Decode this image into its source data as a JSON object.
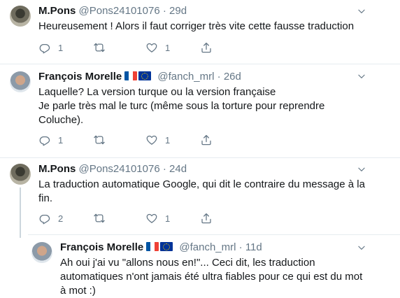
{
  "tweets": [
    {
      "author": "M.Pons",
      "handle": "@Pons24101076",
      "separator": "·",
      "time": "29d",
      "text": "Heureusement ! Alors il faut corriger très vite cette fausse traduction",
      "replies": "1",
      "likes": "1"
    },
    {
      "author": "François Morelle",
      "flags": [
        "flag-fr",
        "flag-eu"
      ],
      "handle": "@fanch_mrl",
      "separator": "·",
      "time": "26d",
      "text_lines": [
        "Laquelle? La version turque ou la version française",
        "Je parle très mal le turc (même sous la torture pour reprendre",
        "Coluche)."
      ],
      "replies": "1",
      "likes": "1"
    },
    {
      "author": "M.Pons",
      "handle": "@Pons24101076",
      "separator": "·",
      "time": "24d",
      "text_lines": [
        "La traduction automatique Google, qui dit le contraire du message à la",
        "fin."
      ],
      "replies": "2",
      "likes": "1"
    },
    {
      "author": "François Morelle",
      "flags": [
        "flag-fr",
        "flag-eu"
      ],
      "handle": "@fanch_mrl",
      "separator": "·",
      "time": "11d",
      "text_lines": [
        "Ah oui j'ai vu \"allons nous en!\"... Ceci dit, les traduction",
        "automatiques n'ont jamais été ultra fiables pour ce qui est du mot",
        "à mot :)"
      ]
    }
  ],
  "icons": {
    "reply": "reply-icon",
    "retweet": "retweet-icon",
    "like": "like-icon",
    "share": "share-icon",
    "more": "chevron-down-icon"
  },
  "colors": {
    "icon": "#657786",
    "divider": "#e6ecf0",
    "thread_line": "#ccd6dd"
  }
}
